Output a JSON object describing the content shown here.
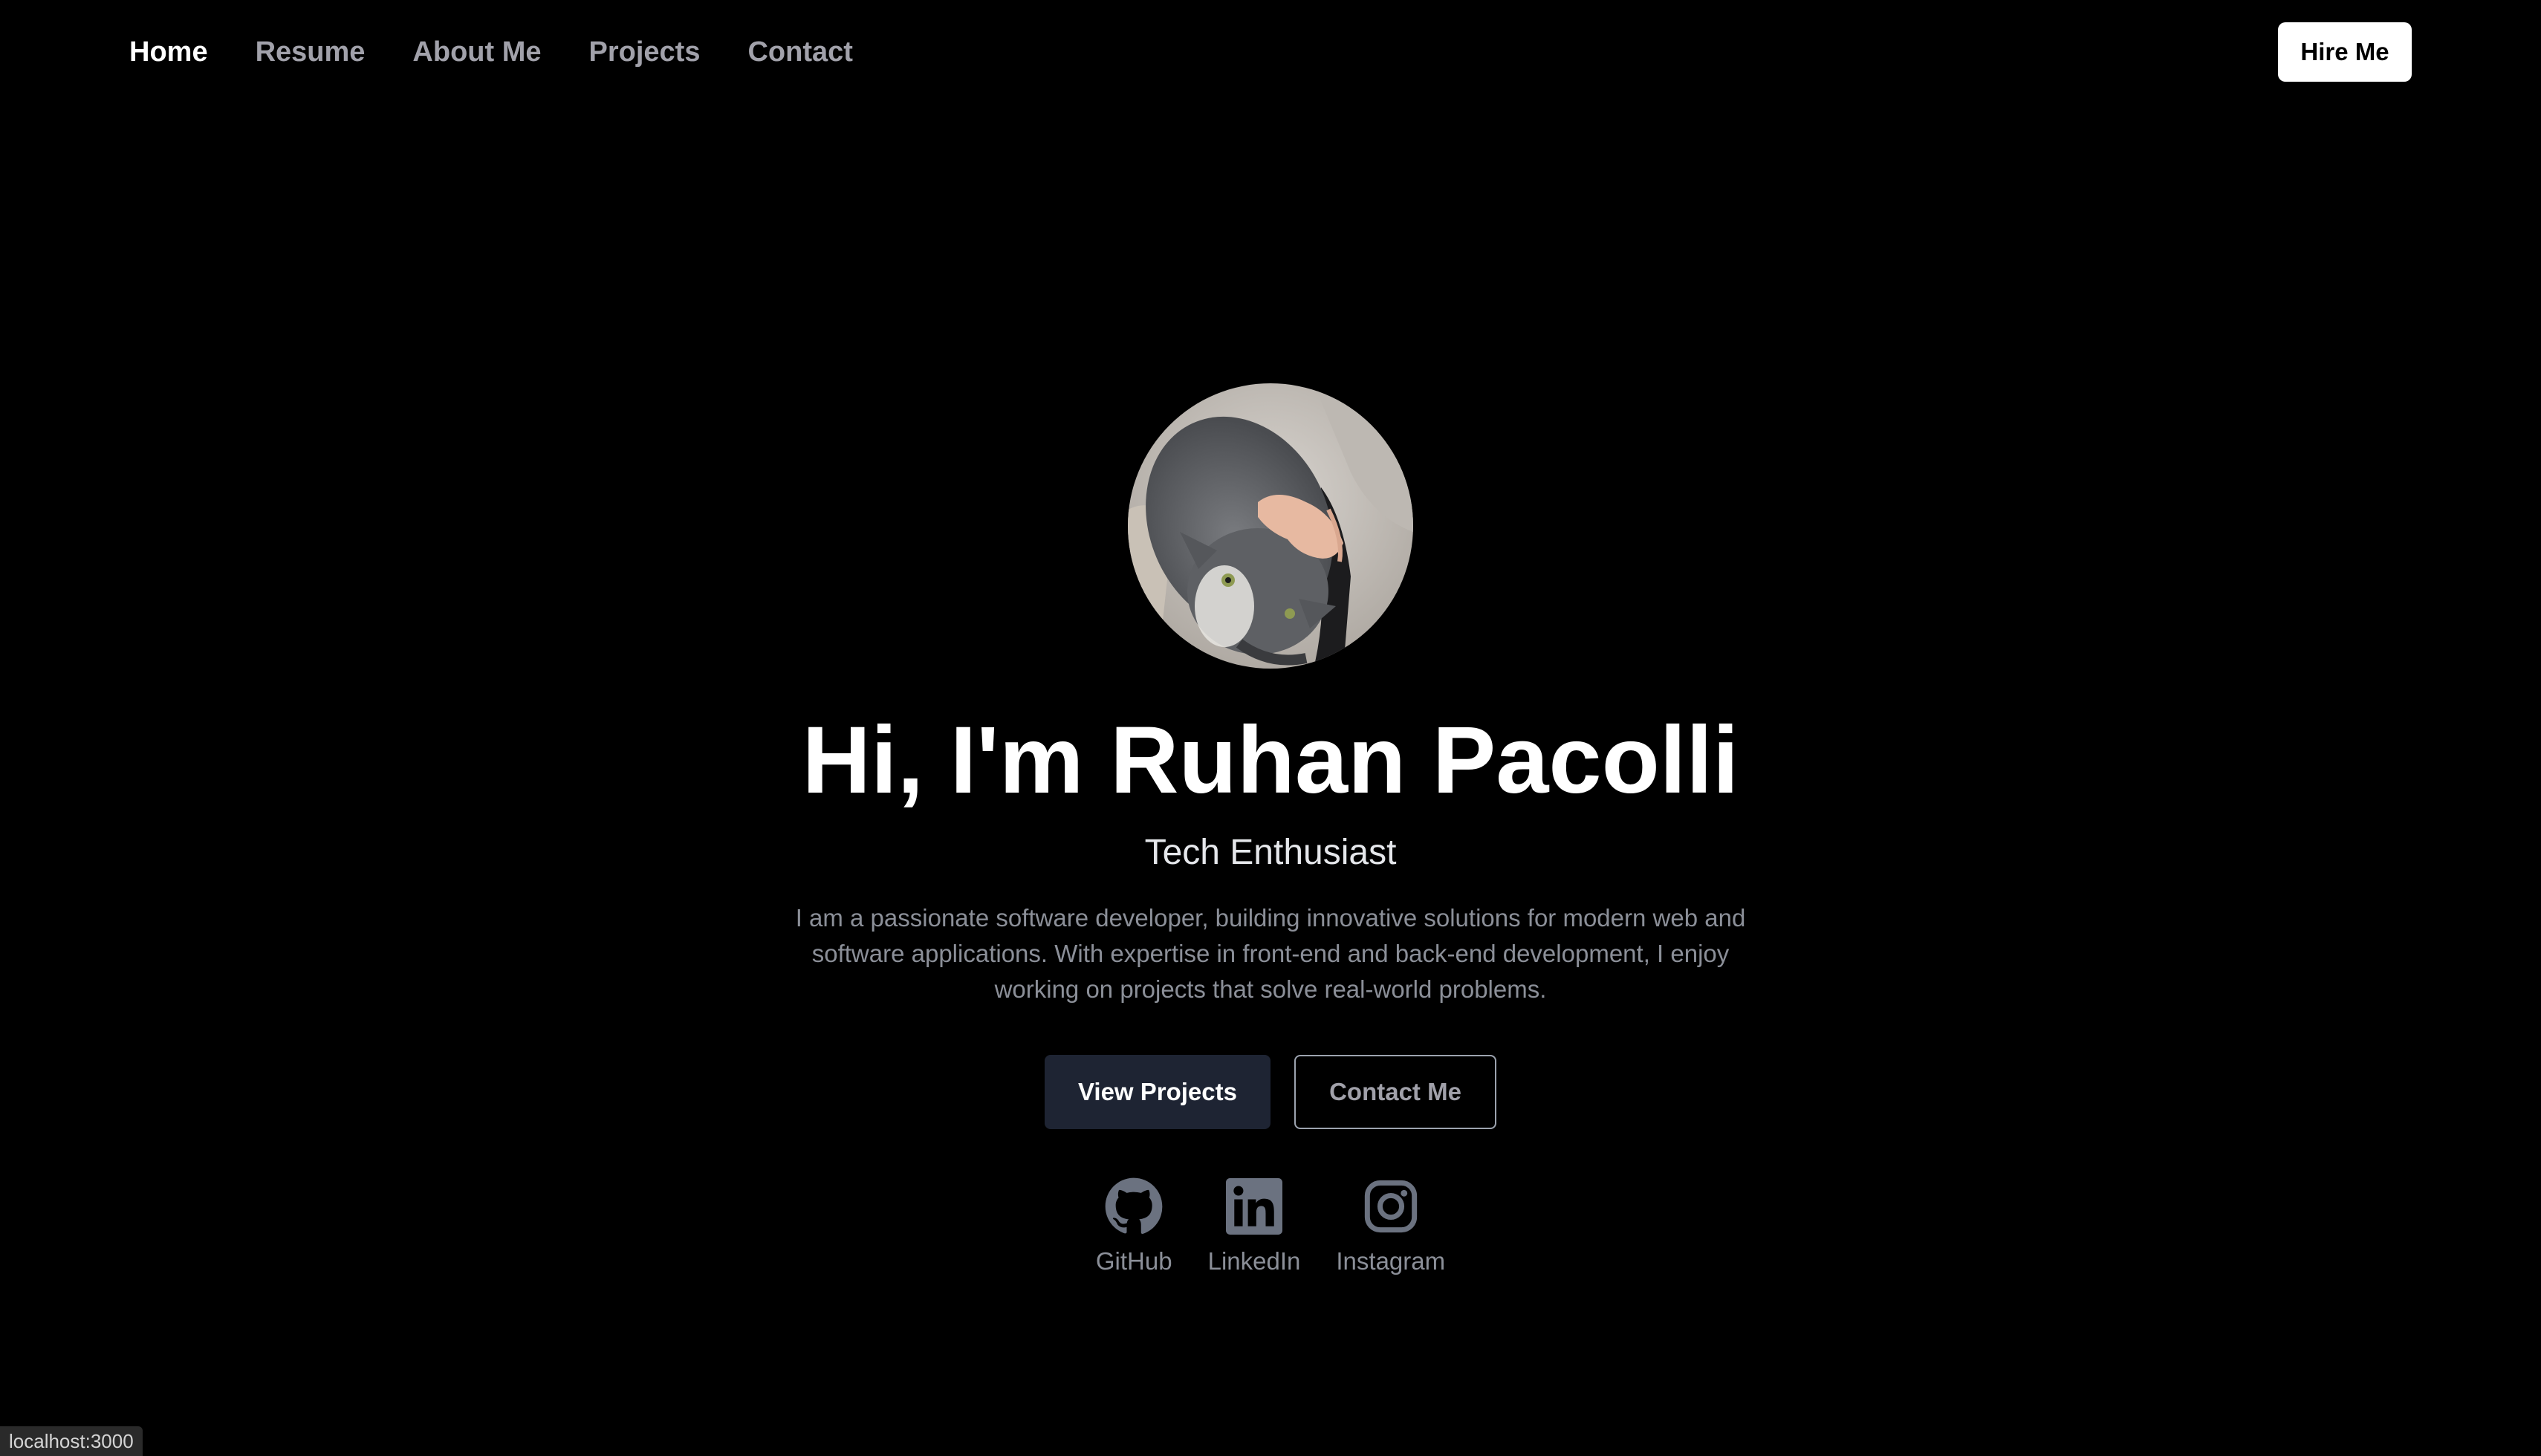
{
  "nav": {
    "links": [
      {
        "label": "Home",
        "active": true
      },
      {
        "label": "Resume",
        "active": false
      },
      {
        "label": "About Me",
        "active": false
      },
      {
        "label": "Projects",
        "active": false
      },
      {
        "label": "Contact",
        "active": false
      }
    ],
    "hire_label": "Hire Me"
  },
  "hero": {
    "title": "Hi, I'm Ruhan Pacolli",
    "subtitle": "Tech Enthusiast",
    "description": "I am a passionate software developer, building innovative solutions for modern web and software applications. With expertise in front-end and back-end development, I enjoy working on projects that solve real-world problems.",
    "primary_button": "View Projects",
    "secondary_button": "Contact Me"
  },
  "socials": [
    {
      "label": "GitHub",
      "icon": "github-icon"
    },
    {
      "label": "LinkedIn",
      "icon": "linkedin-icon"
    },
    {
      "label": "Instagram",
      "icon": "instagram-icon"
    }
  ],
  "status_url": "localhost:3000",
  "colors": {
    "background": "#000000",
    "primary_button": "#1e2433",
    "muted_text": "#8b8f98",
    "icon_gray": "#6b7280"
  }
}
